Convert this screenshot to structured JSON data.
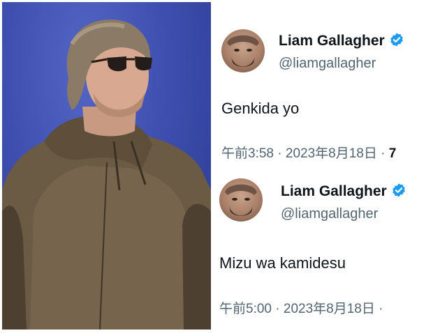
{
  "tweets": [
    {
      "display_name": "Liam Gallagher",
      "handle": "@liamgallagher",
      "text": "Genkida yo",
      "time": "午前3:58",
      "separator": "·",
      "date": "2023年8月18日",
      "separator2": "·",
      "views_partial": "7"
    },
    {
      "display_name": "Liam Gallagher",
      "handle": "@liamgallagher",
      "text": "Mizu wa kamidesu",
      "time": "午前5:00",
      "separator": "·",
      "date": "2023年8月18日",
      "separator2": "·"
    }
  ],
  "colors": {
    "verified_badge": "#1d9bf0",
    "text_primary": "#0f1419",
    "text_secondary": "#536471",
    "stage_background": "#3e4fb0"
  },
  "icons": {
    "verified": "verified-badge-icon"
  }
}
